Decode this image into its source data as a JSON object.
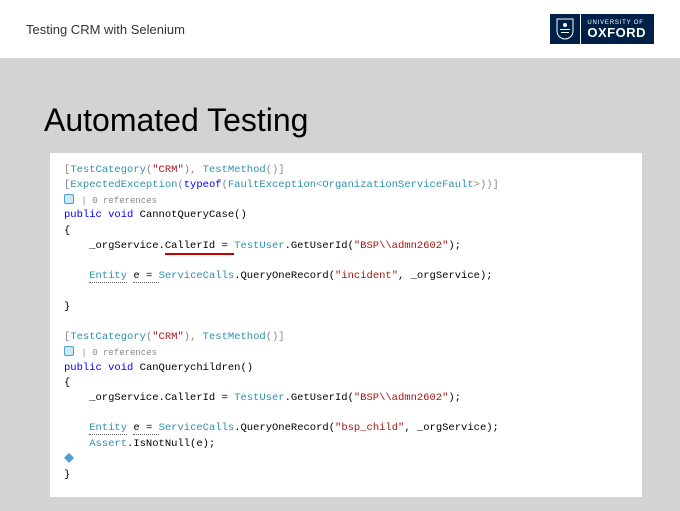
{
  "header": {
    "title": "Testing CRM with Selenium",
    "logo": {
      "small": "UNIVERSITY OF",
      "big": "OXFORD"
    }
  },
  "slide": {
    "title": "Automated Testing"
  },
  "code": {
    "l1a": "[",
    "l1b": "TestCategory",
    "l1c": "(",
    "l1d": "\"CRM\"",
    "l1e": "), ",
    "l1f": "TestMethod",
    "l1g": "()]",
    "l2a": "[",
    "l2b": "ExpectedException",
    "l2c": "(",
    "l2d": "typeof",
    "l2e": "(",
    "l2f": "FaultException",
    "l2g": "<",
    "l2h": "OrganizationServiceFault",
    "l2i": ">))]",
    "refs1": " | 0 references",
    "l3a": "public",
    "l3b": " ",
    "l3c": "void",
    "l3d": " CannotQueryCase()",
    "l4": "{",
    "l5a": "    _orgService.",
    "l5b": "CallerId = ",
    "l5c": "TestUser",
    "l5d": ".GetUserId(",
    "l5e": "\"BSP\\\\admn2602\"",
    "l5f": ");",
    "blank": " ",
    "l6a": "    ",
    "l6b": "Entity",
    "l6c": " ",
    "l6d": "e = ",
    "l6e": "ServiceCalls",
    "l6f": ".QueryOneRecord(",
    "l6g": "\"incident\"",
    "l6h": ", _orgService);",
    "l7": "}",
    "l8a": "[",
    "l8b": "TestCategory",
    "l8c": "(",
    "l8d": "\"CRM\"",
    "l8e": "), ",
    "l8f": "TestMethod",
    "l8g": "()]",
    "refs2": " | 0 references",
    "l9a": "public",
    "l9b": " ",
    "l9c": "void",
    "l9d": " CanQuerychildren()",
    "l10": "{",
    "l11a": "    _orgService.CallerId = ",
    "l11b": "TestUser",
    "l11c": ".GetUserId(",
    "l11d": "\"BSP\\\\admn2602\"",
    "l11e": ");",
    "l12a": "    ",
    "l12b": "Entity",
    "l12c": " ",
    "l12d": "e = ",
    "l12e": "ServiceCalls",
    "l12f": ".QueryOneRecord(",
    "l12g": "\"bsp_child\"",
    "l12h": ", _orgService);",
    "l13a": "    ",
    "l13b": "Assert",
    "l13c": ".IsNotNull(e);",
    "l14": "}"
  }
}
